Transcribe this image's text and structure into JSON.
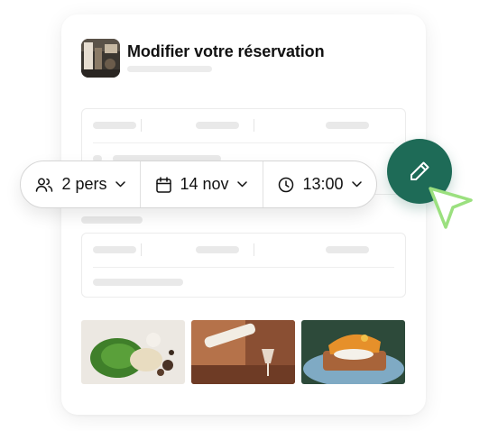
{
  "dialog": {
    "title": "Modifier votre réservation"
  },
  "booking_bar": {
    "guests_label": "2 pers",
    "date_label": "14 nov",
    "time_label": "13:00"
  },
  "icons": {
    "guests": "users-icon",
    "date": "calendar-icon",
    "time": "clock-icon",
    "edit": "pencil-icon",
    "pointer": "cursor-arrow-icon",
    "dropdown": "chevron-down-icon"
  },
  "colors": {
    "accent": "#1e6b57",
    "cursor": "#9be07f",
    "skeleton": "#e9e9e9"
  }
}
